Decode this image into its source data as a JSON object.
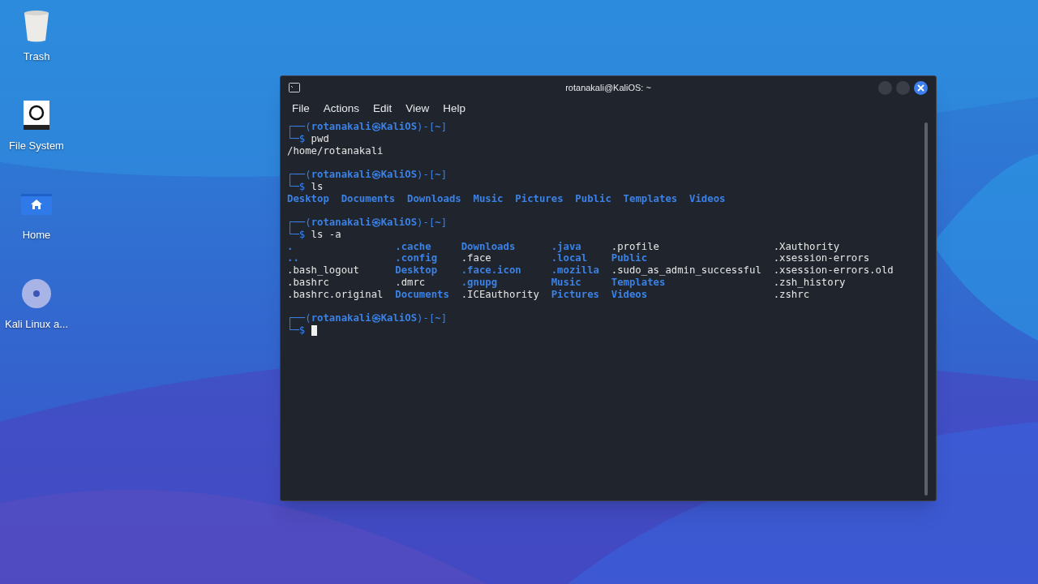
{
  "desktop_icons": [
    {
      "kind": "trash",
      "label": "Trash"
    },
    {
      "kind": "drive",
      "label": "File System"
    },
    {
      "kind": "home",
      "label": "Home"
    },
    {
      "kind": "disc",
      "label": "Kali Linux a..."
    }
  ],
  "window": {
    "title": "rotanakali@KaliOS: ~",
    "menu": [
      "File",
      "Actions",
      "Edit",
      "View",
      "Help"
    ],
    "blocks": [
      {
        "kind": "command",
        "prompt": [
          "┌──(",
          "rotanakali㉿KaliOS",
          ")-[",
          "~",
          "]"
        ],
        "symbol": "└─$",
        "command": "pwd",
        "output": {
          "kind": "text",
          "lines": [
            "/home/rotanakali"
          ]
        }
      },
      {
        "kind": "command",
        "prompt": [
          "┌──(",
          "rotanakali㉿KaliOS",
          ")-[",
          "~",
          "]"
        ],
        "symbol": "└─$",
        "command": "ls",
        "output": {
          "kind": "row",
          "items": [
            {
              "text": "Desktop",
              "kind": "dir"
            },
            {
              "text": "Documents",
              "kind": "dir"
            },
            {
              "text": "Downloads",
              "kind": "dir"
            },
            {
              "text": "Music",
              "kind": "dir"
            },
            {
              "text": "Pictures",
              "kind": "dir"
            },
            {
              "text": "Public",
              "kind": "dir"
            },
            {
              "text": "Templates",
              "kind": "dir"
            },
            {
              "text": "Videos",
              "kind": "dir"
            }
          ]
        }
      },
      {
        "kind": "command",
        "prompt": [
          "┌──(",
          "rotanakali㉿KaliOS",
          ")-[",
          "~",
          "]"
        ],
        "symbol": "└─$",
        "command": "ls -a",
        "output": {
          "kind": "columns",
          "columns": [
            [
              {
                "text": ".",
                "kind": "dir"
              },
              {
                "text": "..",
                "kind": "dir"
              },
              {
                "text": ".bash_logout",
                "kind": "file"
              },
              {
                "text": ".bashrc",
                "kind": "file"
              },
              {
                "text": ".bashrc.original",
                "kind": "file"
              }
            ],
            [
              {
                "text": ".cache",
                "kind": "dir"
              },
              {
                "text": ".config",
                "kind": "dir"
              },
              {
                "text": "Desktop",
                "kind": "dir"
              },
              {
                "text": ".dmrc",
                "kind": "file"
              },
              {
                "text": "Documents",
                "kind": "dir"
              }
            ],
            [
              {
                "text": "Downloads",
                "kind": "dir"
              },
              {
                "text": ".face",
                "kind": "file"
              },
              {
                "text": ".face.icon",
                "kind": "dir"
              },
              {
                "text": ".gnupg",
                "kind": "dir"
              },
              {
                "text": ".ICEauthority",
                "kind": "file"
              }
            ],
            [
              {
                "text": ".java",
                "kind": "dir"
              },
              {
                "text": ".local",
                "kind": "dir"
              },
              {
                "text": ".mozilla",
                "kind": "dir"
              },
              {
                "text": "Music",
                "kind": "dir"
              },
              {
                "text": "Pictures",
                "kind": "dir"
              }
            ],
            [
              {
                "text": ".profile",
                "kind": "file"
              },
              {
                "text": "Public",
                "kind": "dir"
              },
              {
                "text": ".sudo_as_admin_successful",
                "kind": "file"
              },
              {
                "text": "Templates",
                "kind": "dir"
              },
              {
                "text": "Videos",
                "kind": "dir"
              }
            ],
            [
              {
                "text": ".Xauthority",
                "kind": "file"
              },
              {
                "text": ".xsession-errors",
                "kind": "file"
              },
              {
                "text": ".xsession-errors.old",
                "kind": "file"
              },
              {
                "text": ".zsh_history",
                "kind": "file"
              },
              {
                "text": ".zshrc",
                "kind": "file"
              }
            ]
          ]
        }
      },
      {
        "kind": "input",
        "prompt": [
          "┌──(",
          "rotanakali㉿KaliOS",
          ")-[",
          "~",
          "]"
        ],
        "symbol": "└─$"
      }
    ]
  }
}
